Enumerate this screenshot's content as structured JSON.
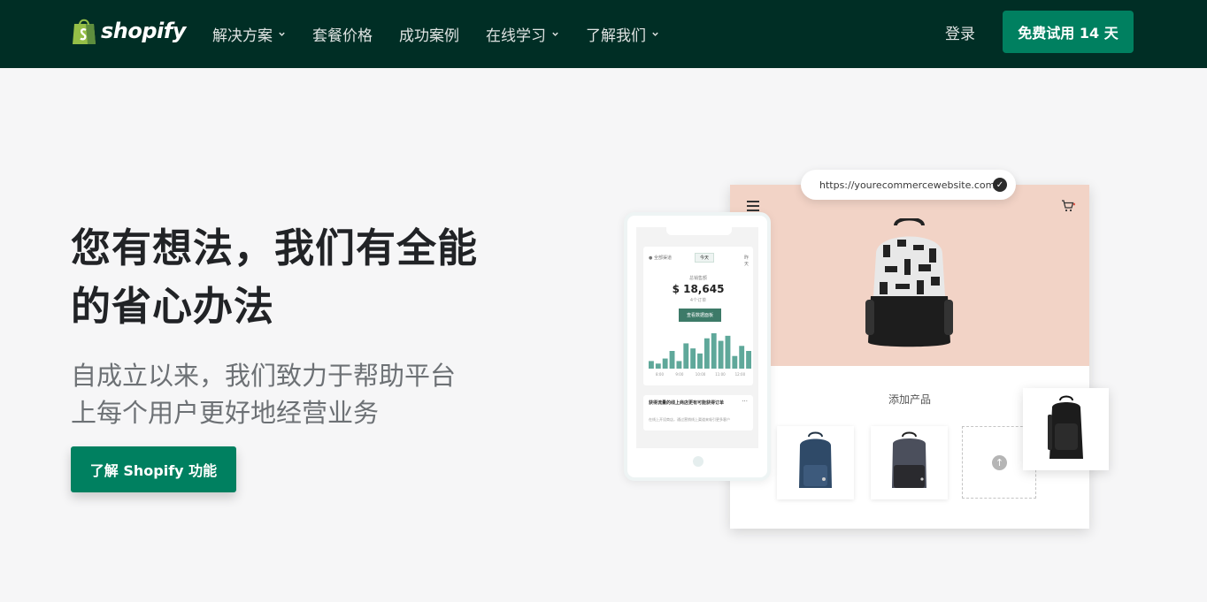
{
  "nav": {
    "logo_text": "shopify",
    "items": [
      {
        "label": "解决方案",
        "has_dropdown": true
      },
      {
        "label": "套餐价格",
        "has_dropdown": false
      },
      {
        "label": "成功案例",
        "has_dropdown": false
      },
      {
        "label": "在线学习",
        "has_dropdown": true
      },
      {
        "label": "了解我们",
        "has_dropdown": true
      }
    ],
    "login_label": "登录",
    "trial_label": "免费试用 14 天"
  },
  "hero": {
    "title_line1": "您有想法，我们有全能",
    "title_line2": "的省心办法",
    "subtitle_line1": "自成立以来，我们致力于帮助平台",
    "subtitle_line2": "上每个用户更好地经营业务",
    "cta_label": "了解 Shopify 功能"
  },
  "illustration": {
    "url": "https://yourecommercewebsite.com",
    "add_product_label": "添加产品",
    "phone": {
      "tab_left": "●  全部渠道",
      "tab_active": "今天",
      "tab_right": "昨天",
      "stat_label": "总销售额",
      "stat_value": "$ 18,645",
      "stat_sub": "4个订单",
      "stat_button": "查看数据面板",
      "axis_labels": [
        "8:00",
        "9:00",
        "10:00",
        "11:00",
        "12:00"
      ],
      "bar_values": [
        3,
        2,
        4,
        7,
        3,
        10,
        8,
        6,
        12,
        14,
        11,
        13,
        5,
        9,
        7
      ],
      "note_title": "获得流量的线上商店更有可能获得订单",
      "note_body": "在线上开设商店，通过营销线上渠道来吸引更多客户"
    }
  },
  "colors": {
    "nav_bg": "#002e25",
    "brand_green": "#008060",
    "page_bg": "#f6f6f7",
    "peach": "#f2d3c6",
    "chart_teal": "#5fa89a"
  }
}
